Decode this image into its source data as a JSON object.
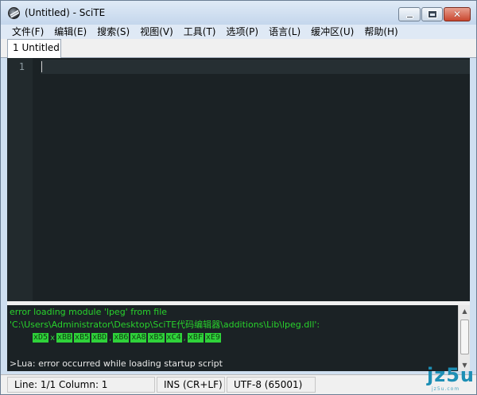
{
  "window": {
    "title": "(Untitled) - SciTE",
    "close_glyph": "✕"
  },
  "menu": [
    {
      "label": "文件(F)"
    },
    {
      "label": "编辑(E)"
    },
    {
      "label": "搜索(S)"
    },
    {
      "label": "视图(V)"
    },
    {
      "label": "工具(T)"
    },
    {
      "label": "选项(P)"
    },
    {
      "label": "语言(L)"
    },
    {
      "label": "缓冲区(U)"
    },
    {
      "label": "帮助(H)"
    }
  ],
  "tabs": [
    {
      "label": "1 Untitled"
    }
  ],
  "editor": {
    "line_numbers": [
      "1"
    ]
  },
  "output": {
    "line1": "error loading module 'lpeg' from file",
    "line2": "'C:\\Users\\Administrator\\Desktop\\SciTE代码编辑器\\additions\\Lib\\lpeg.dll':",
    "hex_tokens": [
      "xD5",
      "x",
      "xBB",
      "xB5",
      "xBD",
      ",",
      "xB6",
      "xA8",
      "xB5",
      "xC4",
      ",",
      "xBF",
      "xE9"
    ],
    "line4": ">Lua: error occurred while loading startup script"
  },
  "status": {
    "position": "Line: 1/1  Column: 1",
    "mode": "INS (CR+LF)",
    "encoding": "UTF-8 (65001)"
  },
  "watermark": {
    "j": "j",
    "text": "jz5u",
    "sub": "jz5u.com"
  },
  "colors": {
    "editor_bg": "#1b2225",
    "output_text": "#28d22c",
    "accent": "#1d8fb5"
  }
}
